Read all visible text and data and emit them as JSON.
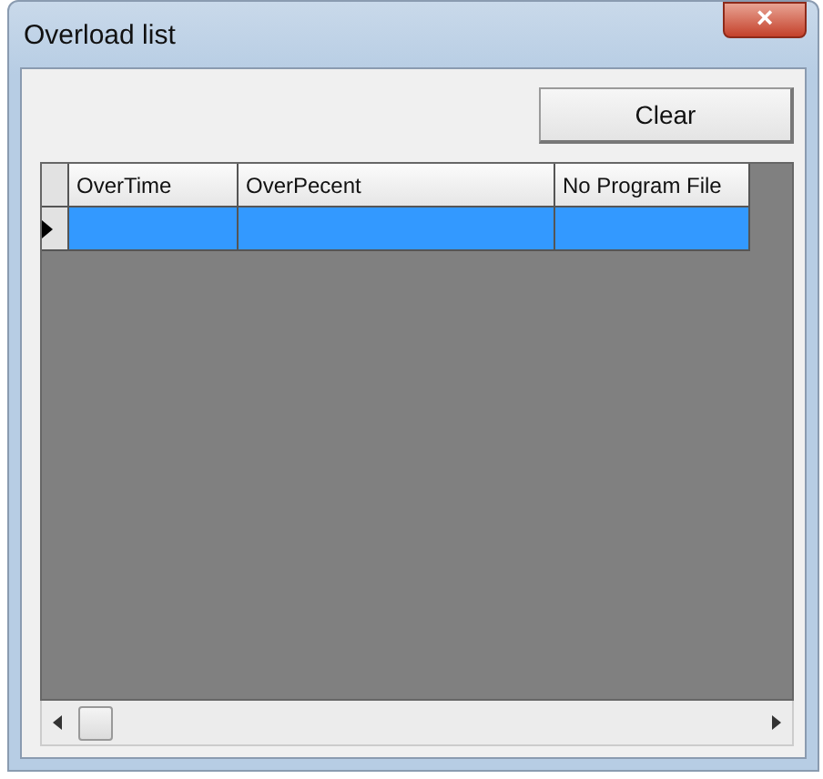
{
  "window": {
    "title": "Overload list",
    "close": "×"
  },
  "clear_button": "Clear",
  "table": {
    "columns": [
      "OverTime",
      "OverPecent",
      "No Program File"
    ],
    "rows": [
      {
        "cells": [
          "",
          "",
          ""
        ],
        "selected": true
      }
    ]
  }
}
